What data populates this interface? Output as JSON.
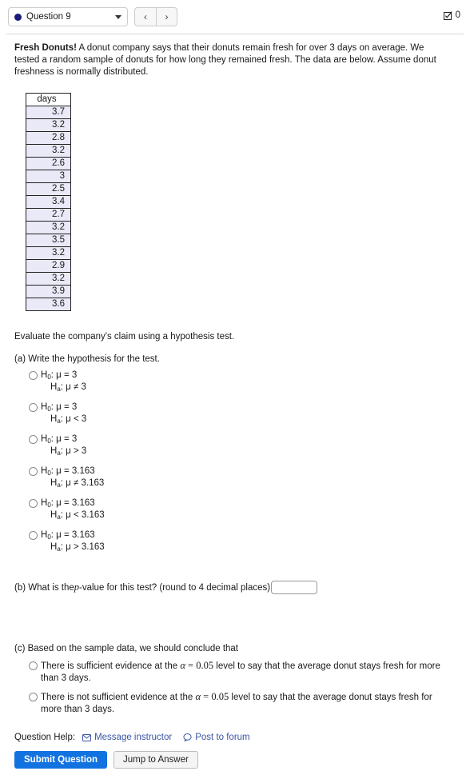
{
  "header": {
    "question_selector_label": "Question 9",
    "prev_label": "‹",
    "next_label": "›",
    "score_value": "0"
  },
  "question": {
    "title": "Fresh Donuts!",
    "body": " A donut company says that their donuts remain fresh for over 3 days on average. We tested a random sample of donuts for how long they remained fresh. The data are below. Assume donut freshness is normally distributed.",
    "evaluate_text": "Evaluate the company's claim using a hypothesis test."
  },
  "data_table": {
    "header": "days",
    "values": [
      "3.7",
      "3.2",
      "2.8",
      "3.2",
      "2.6",
      "3",
      "2.5",
      "3.4",
      "2.7",
      "3.2",
      "3.5",
      "3.2",
      "2.9",
      "3.2",
      "3.9",
      "3.6"
    ]
  },
  "part_a": {
    "prompt": "(a) Write the hypothesis for the test.",
    "options": [
      {
        "null": "H",
        "null_sub": "0",
        "null_rest": ": μ = 3",
        "alt": "H",
        "alt_sub": "a",
        "alt_rest": ": μ ≠ 3"
      },
      {
        "null": "H",
        "null_sub": "0",
        "null_rest": ": μ = 3",
        "alt": "H",
        "alt_sub": "a",
        "alt_rest": ": μ < 3"
      },
      {
        "null": "H",
        "null_sub": "0",
        "null_rest": ": μ = 3",
        "alt": "H",
        "alt_sub": "a",
        "alt_rest": ": μ > 3"
      },
      {
        "null": "H",
        "null_sub": "0",
        "null_rest": ": μ = 3.163",
        "alt": "H",
        "alt_sub": "a",
        "alt_rest": ": μ ≠ 3.163"
      },
      {
        "null": "H",
        "null_sub": "0",
        "null_rest": ": μ = 3.163",
        "alt": "H",
        "alt_sub": "a",
        "alt_rest": ": μ < 3.163"
      },
      {
        "null": "H",
        "null_sub": "0",
        "null_rest": ": μ = 3.163",
        "alt": "H",
        "alt_sub": "a",
        "alt_rest": ": μ > 3.163"
      }
    ]
  },
  "part_b": {
    "prefix": "(b) What is the ",
    "math_p": "p",
    "suffix": "-value for this test? (round to 4 decimal places)",
    "input_value": "",
    "input_placeholder": ""
  },
  "part_c": {
    "prompt": "(c) Based on the sample data, we should conclude that",
    "options": [
      {
        "pre": "There is sufficient evidence at the ",
        "alpha": "α",
        "eq": " = ",
        "level": "0.05",
        "post": " level to say that the average donut stays fresh for more than 3 days."
      },
      {
        "pre": "There is not sufficient evidence at the ",
        "alpha": "α",
        "eq": " = ",
        "level": "0.05",
        "post": " level to say that the average donut stays fresh for more than 3 days."
      }
    ]
  },
  "footer": {
    "help_label": "Question Help:",
    "message_instructor": "Message instructor",
    "post_to_forum": "Post to forum",
    "submit_label": "Submit Question",
    "jump_label": "Jump to Answer"
  },
  "colors": {
    "accent_blue": "#1272e0",
    "link_blue": "#3a55a5",
    "table_cell_bg": "#e9e9f7",
    "bullet_navy": "#1a1a7a"
  }
}
